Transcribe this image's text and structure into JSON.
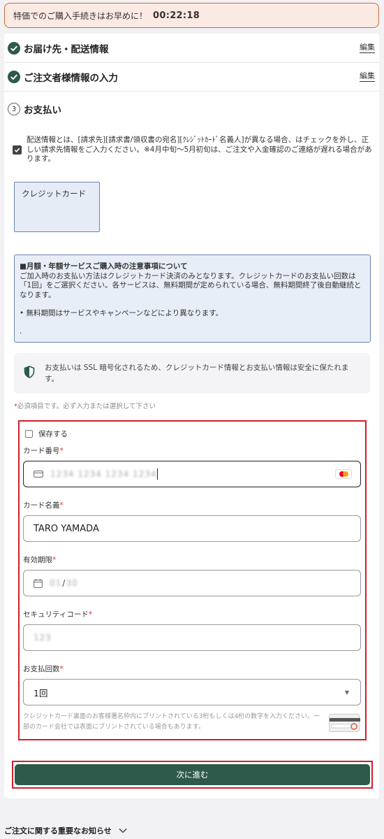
{
  "timer": {
    "message": "特価でのご購入手続きはお早めに！",
    "time": "00:22:18"
  },
  "steps": [
    {
      "title": "お届け先・配送情報",
      "edit": "編集"
    },
    {
      "title": "ご注文者様情報の入力",
      "edit": "編集"
    },
    {
      "number": "3",
      "title": "お支払い"
    }
  ],
  "notice": {
    "text": "配送情報とは、[請求先][請求書/領収書の宛名][ｸﾚｼﾞｯﾄｶｰﾄﾞ名義人]が異なる場合、はチェックを外し、正しい請求先情報をご入力ください。※4月中旬〜5月初旬は、ご注文や入金確認のご連絡が遅れる場合があります。"
  },
  "payment_method": {
    "label": "クレジットカード"
  },
  "info": {
    "heading": "■月額・年額サービスご購入時の注意事項について",
    "body": "ご加入時のお支払い方法はクレジットカード決済のみとなります。クレジットカードのお支払い回数は「1回」をご選択ください。各サービスは、無料期間が定められている場合、無料期間終了後自動継続となります。",
    "bullet": "• 無料期間はサービスやキャンペーンなどにより異なります。",
    "dot": "."
  },
  "ssl": {
    "text": "お支払いは SSL 暗号化されるため、クレジットカード情報とお支払い情報は安全に保たれます。"
  },
  "required_note": {
    "mark": "*",
    "text": "必須項目です。必ず入力または選択して下さい"
  },
  "form": {
    "save_label": "保存する",
    "card_number_label": "カード番号",
    "card_number_placeholder": "1234 1234 1234 1234",
    "card_name_label": "カード名義",
    "card_name_value": "TARO YAMADA",
    "expiry_label": "有効期限",
    "expiry_month": "01",
    "expiry_sep": "/",
    "expiry_year": "30",
    "cvc_label": "セキュリティコード",
    "cvc_placeholder": "123",
    "installments_label": "お支払回数",
    "installments_value": "1回",
    "required_mark": "*",
    "cvc_hint": "クレジットカード裏面のお客様署名枠内にプリントされている3桁もしくは4桁の数字を入力ください。一部のカード会社では表面にプリントされている場合もあります。"
  },
  "next_button": "次に進む",
  "footer": {
    "label": "ご注文に関する重要なお知らせ"
  },
  "colors": {
    "accent": "#2d5a4b",
    "highlight_border": "#d0202a",
    "info_border": "#6c82b8"
  }
}
